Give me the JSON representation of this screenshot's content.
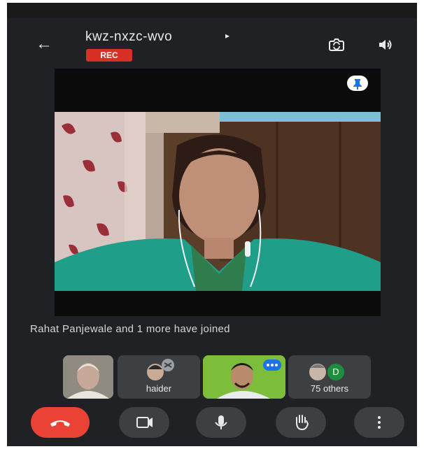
{
  "header": {
    "meeting_code": "kwz-nxzc-wvo",
    "rec_label": "REC"
  },
  "notification": {
    "text": "Rahat Panjewale and 1 more have joined"
  },
  "participants": {
    "tiles": [
      {
        "name": ""
      },
      {
        "name": "haider"
      },
      {
        "name": ""
      },
      {
        "name": "75 others"
      }
    ],
    "others_avatar_letter": "D"
  },
  "controls": {
    "icons": [
      "end-call-icon",
      "camera-icon",
      "mic-icon",
      "raise-hand-icon",
      "more-options-icon"
    ]
  },
  "colors": {
    "background": "#202124",
    "rec": "#d93025",
    "end_call": "#ea4335",
    "control_bg": "#3c4043",
    "speaker_tile": "#7dbd3a",
    "avatar_d": "#1e8e3e"
  }
}
